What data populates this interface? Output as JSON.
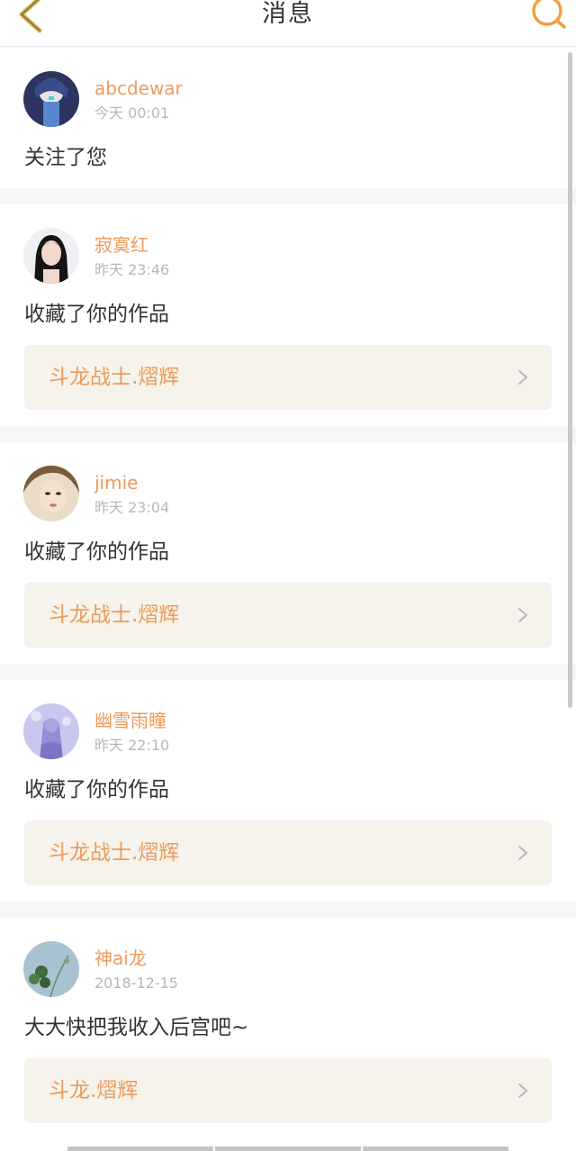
{
  "header": {
    "title": "消息",
    "back_icon": "chevron-left-icon",
    "search_icon": "search-icon",
    "accent_color": "#f0a040"
  },
  "colors": {
    "username": "#ee9a5b",
    "work_title": "#ee9a5b",
    "work_bg": "#f5f3ec",
    "page_bg": "#f7f6f4"
  },
  "messages": [
    {
      "username": "abcdewar",
      "time": "今天 00:01",
      "action": "关注了您",
      "avatar_icon": "avatar-anime-boy"
    },
    {
      "username": "寂寞红",
      "time": "昨天 23:46",
      "action": "收藏了你的作品",
      "work": "斗龙战士.熠辉",
      "avatar_icon": "avatar-girl-dark-hair"
    },
    {
      "username": "jimie",
      "time": "昨天 23:04",
      "action": "收藏了你的作品",
      "work": "斗龙战士.熠辉",
      "avatar_icon": "avatar-girl-portrait"
    },
    {
      "username": "幽雪雨瞳",
      "time": "昨天 22:10",
      "action": "收藏了你的作品",
      "work": "斗龙战士.熠辉",
      "avatar_icon": "avatar-anime-purple"
    },
    {
      "username": "神ai龙",
      "time": "2018-12-15",
      "action": "大大快把我收入后宫吧~",
      "work": "斗龙.熠辉",
      "avatar_icon": "avatar-plant"
    }
  ]
}
